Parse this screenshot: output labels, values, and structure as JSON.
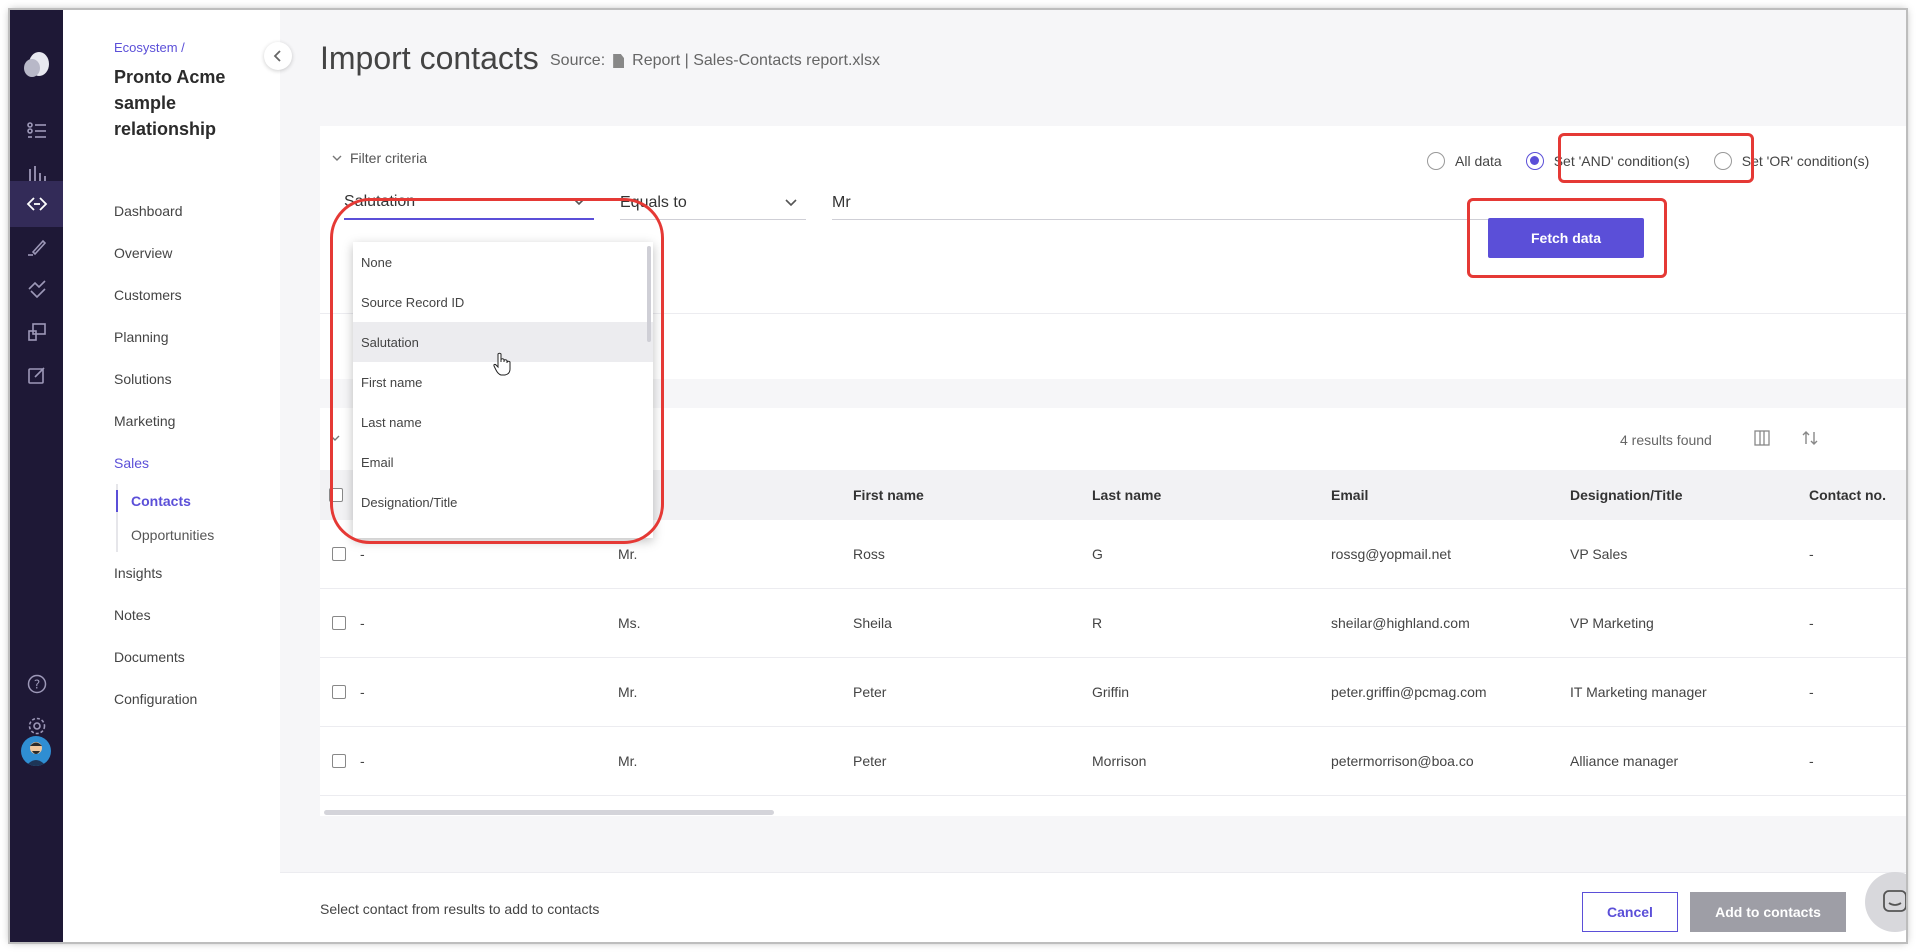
{
  "sidebar": {
    "breadcrumb": "Ecosystem /",
    "title": "Pronto Acme sample relationship",
    "items": [
      {
        "label": "Dashboard"
      },
      {
        "label": "Overview"
      },
      {
        "label": "Customers"
      },
      {
        "label": "Planning"
      },
      {
        "label": "Solutions"
      },
      {
        "label": "Marketing"
      },
      {
        "label": "Sales"
      }
    ],
    "sub_items": [
      {
        "label": "Contacts"
      },
      {
        "label": "Opportunities"
      }
    ],
    "items_after": [
      {
        "label": "Insights"
      },
      {
        "label": "Notes"
      },
      {
        "label": "Documents"
      },
      {
        "label": "Configuration"
      }
    ]
  },
  "header": {
    "title": "Import contacts",
    "source_label": "Source:",
    "source_value": "Report |  Sales-Contacts report.xlsx"
  },
  "filter": {
    "toggle_label": "Filter criteria",
    "radios": [
      {
        "label": "All data",
        "selected": false
      },
      {
        "label": "Set 'AND' condition(s)",
        "selected": true
      },
      {
        "label": "Set 'OR' condition(s)",
        "selected": false
      }
    ],
    "field_value": "Salutation",
    "operator_value": "Equals to",
    "criteria_value": "Mr",
    "fetch_label": "Fetch data",
    "dropdown_options": [
      "None",
      "Source Record ID",
      "Salutation",
      "First name",
      "Last name",
      "Email",
      "Designation/Title"
    ],
    "hovered_option": "Salutation"
  },
  "results": {
    "count_label": "4 results found",
    "columns": [
      "",
      "tion",
      "First name",
      "Last name",
      "Email",
      "Designation/Title",
      "Contact no."
    ],
    "rows": [
      {
        "id": "-",
        "salutation": "Mr.",
        "first": "Ross",
        "last": "G",
        "email": "rossg@yopmail.net",
        "title": "VP Sales",
        "contact": "-"
      },
      {
        "id": "-",
        "salutation": "Ms.",
        "first": "Sheila",
        "last": "R",
        "email": "sheilar@highland.com",
        "title": "VP Marketing",
        "contact": "-"
      },
      {
        "id": "-",
        "salutation": "Mr.",
        "first": "Peter",
        "last": "Griffin",
        "email": "peter.griffin@pcmag.com",
        "title": "IT Marketing manager",
        "contact": "-"
      },
      {
        "id": "-",
        "salutation": "Mr.",
        "first": "Peter",
        "last": "Morrison",
        "email": "petermorrison@boa.co",
        "title": "Alliance manager",
        "contact": "-"
      }
    ]
  },
  "footer": {
    "message": "Select contact from results to add to contacts",
    "cancel_label": "Cancel",
    "add_label": "Add to contacts"
  },
  "colors": {
    "accent": "#5b4fd8",
    "rail": "#1e1836",
    "highlight": "#e53935",
    "disabled": "#9e9ea6"
  }
}
